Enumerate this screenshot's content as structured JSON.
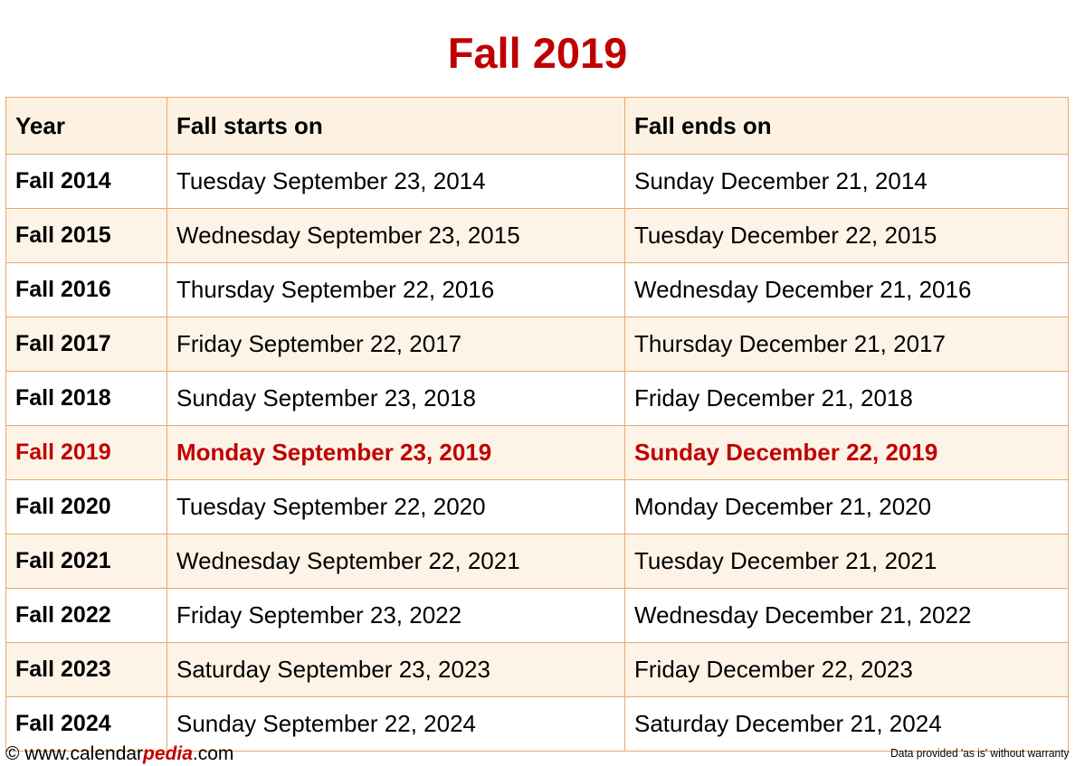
{
  "title": "Fall 2019",
  "colors": {
    "accent_red": "#c00000",
    "border_orange": "#e8a86d",
    "row_cream": "#fdf4e7",
    "header_cream": "#fdf2e2",
    "row_white": "#ffffff"
  },
  "table": {
    "columns": [
      "Year",
      "Fall starts on",
      "Fall ends on"
    ],
    "highlight_year": "Fall 2019",
    "rows": [
      {
        "year": "Fall 2014",
        "start": "Tuesday September 23, 2014",
        "end": "Sunday December 21, 2014"
      },
      {
        "year": "Fall 2015",
        "start": "Wednesday September 23, 2015",
        "end": "Tuesday December 22, 2015"
      },
      {
        "year": "Fall 2016",
        "start": "Thursday September 22, 2016",
        "end": "Wednesday December 21, 2016"
      },
      {
        "year": "Fall 2017",
        "start": "Friday September 22, 2017",
        "end": "Thursday December 21, 2017"
      },
      {
        "year": "Fall 2018",
        "start": "Sunday September 23, 2018",
        "end": "Friday December 21, 2018"
      },
      {
        "year": "Fall 2019",
        "start": "Monday September 23, 2019",
        "end": "Sunday December 22, 2019"
      },
      {
        "year": "Fall 2020",
        "start": "Tuesday September 22, 2020",
        "end": "Monday December 21, 2020"
      },
      {
        "year": "Fall 2021",
        "start": "Wednesday September 22, 2021",
        "end": "Tuesday December 21, 2021"
      },
      {
        "year": "Fall 2022",
        "start": "Friday September 23, 2022",
        "end": "Wednesday December 21, 2022"
      },
      {
        "year": "Fall 2023",
        "start": "Saturday September 23, 2023",
        "end": "Friday December 22, 2023"
      },
      {
        "year": "Fall 2024",
        "start": "Sunday September 22, 2024",
        "end": "Saturday December 21, 2024"
      }
    ]
  },
  "footer": {
    "copyright_symbol": "©",
    "site_prefix": " www.calendar",
    "site_brand": "pedia",
    "site_suffix": ".com",
    "disclaimer": "Data provided 'as is' without warranty"
  }
}
